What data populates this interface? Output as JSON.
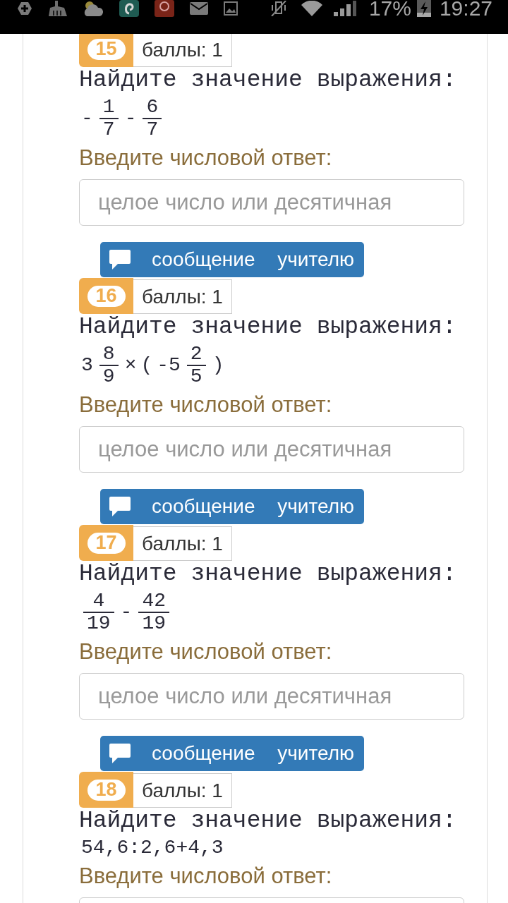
{
  "status_bar": {
    "battery": "17%",
    "time": "19:27"
  },
  "questions": [
    {
      "number": "15",
      "score": "баллы: 1",
      "prompt": "Найдите значение выражения:",
      "expression": [
        {
          "kind": "text",
          "text": "-"
        },
        {
          "kind": "fraction",
          "numerator": "1",
          "denominator": "7"
        },
        {
          "kind": "text",
          "text": "-"
        },
        {
          "kind": "fraction",
          "numerator": "6",
          "denominator": "7"
        }
      ],
      "answer": {
        "label": "Введите числовой ответ:",
        "placeholder": "целое число или десятичная"
      },
      "message_button": "сообщение учителю"
    },
    {
      "number": "16",
      "score": "баллы: 1",
      "prompt": "Найдите значение выражения:",
      "expression": [
        {
          "kind": "text",
          "text": "3"
        },
        {
          "kind": "fraction",
          "numerator": "8",
          "denominator": "9"
        },
        {
          "kind": "text",
          "text": "×"
        },
        {
          "kind": "text",
          "text": "("
        },
        {
          "kind": "text",
          "text": "-5"
        },
        {
          "kind": "fraction",
          "numerator": "2",
          "denominator": "5"
        },
        {
          "kind": "text",
          "text": ")"
        }
      ],
      "answer": {
        "label": "Введите числовой ответ:",
        "placeholder": "целое число или десятичная"
      },
      "message_button": "сообщение учителю"
    },
    {
      "number": "17",
      "score": "баллы: 1",
      "prompt": "Найдите значение выражения:",
      "expression": [
        {
          "kind": "fraction",
          "numerator": "4",
          "denominator": "19"
        },
        {
          "kind": "text",
          "text": "-"
        },
        {
          "kind": "fraction",
          "numerator": "42",
          "denominator": "19"
        }
      ],
      "answer": {
        "label": "Введите числовой ответ:",
        "placeholder": "целое число или десятичная"
      },
      "message_button": "сообщение учителю"
    },
    {
      "number": "18",
      "score": "баллы: 1",
      "prompt": "Найдите значение выражения:",
      "expression": [
        {
          "kind": "text",
          "text": "54,6:2,6+4,3"
        }
      ],
      "answer": {
        "label": "Введите числовой ответ:"
      }
    }
  ]
}
